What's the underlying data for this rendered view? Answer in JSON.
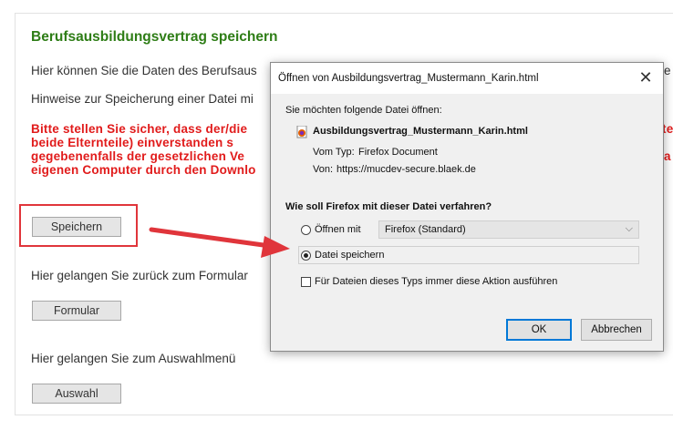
{
  "page": {
    "title": "Berufsausbildungsvertrag speichern",
    "line1": "Hier können Sie die Daten des Berufsaus",
    "line2": "Hinweise zur Speicherung einer Datei mi",
    "warning": [
      "Bitte stellen Sie sicher, dass der/die",
      "beide Elternteile) einverstanden s",
      "gegebenenfalls der gesetzlichen Ve",
      "eigenen Computer durch den Downlo"
    ],
    "save_button": "Speichern",
    "back_text": "Hier gelangen Sie zurück zum Formular",
    "form_button": "Formular",
    "menu_text": "Hier gelangen Sie zum Auswahlmenü",
    "select_button": "Auswahl",
    "right_edge_fragments": [
      "e",
      "te",
      "a"
    ]
  },
  "dialog": {
    "title": "Öffnen von Ausbildungsvertrag_Mustermann_Karin.html",
    "intro": "Sie möchten folgende Datei öffnen:",
    "filename": "Ausbildungsvertrag_Mustermann_Karin.html",
    "type_label": "Vom Typ:",
    "type_value": "Firefox Document",
    "from_label": "Von:",
    "from_value": "https://mucdev-secure.blaek.de",
    "question": "Wie soll Firefox mit dieser Datei verfahren?",
    "open_with_label": "Öffnen mit",
    "open_with_value": "Firefox (Standard)",
    "save_file_label": "Datei speichern",
    "always_label": "Für Dateien dieses Typs immer diese Aktion ausführen",
    "ok_label": "OK",
    "cancel_label": "Abbrechen",
    "selected_option": "save"
  },
  "colors": {
    "title_green": "#2e7d16",
    "warning_red": "#e11b1b",
    "annotation_red": "#e0353b"
  }
}
